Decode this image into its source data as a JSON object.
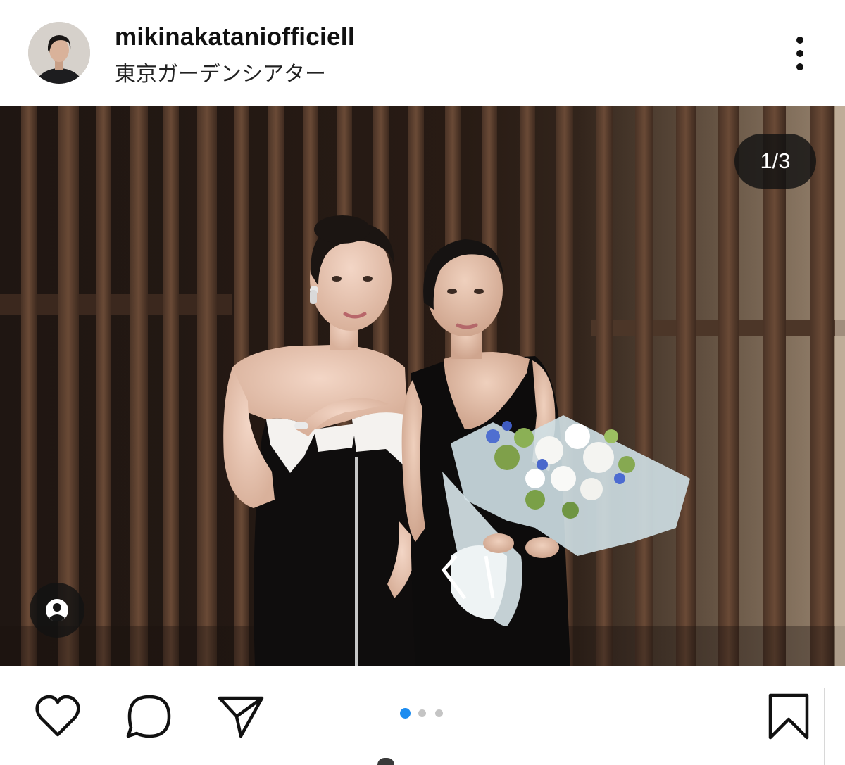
{
  "post": {
    "username": "mikinakataniofficiell",
    "location": "東京ガーデンシアター",
    "carousel": {
      "current_label": "1/3",
      "current_index": 1,
      "total": 3
    }
  },
  "icons": {
    "avatar": "profile-avatar",
    "more": "more-options-icon",
    "tags": "user-tag-icon",
    "like": "heart-icon",
    "comment": "comment-bubble-icon",
    "share": "paper-plane-icon",
    "save": "bookmark-icon"
  },
  "colors": {
    "carousel_active_dot": "#1c8cf0",
    "carousel_inactive_dot": "#c4c4c4",
    "icon_stroke": "#111111"
  }
}
